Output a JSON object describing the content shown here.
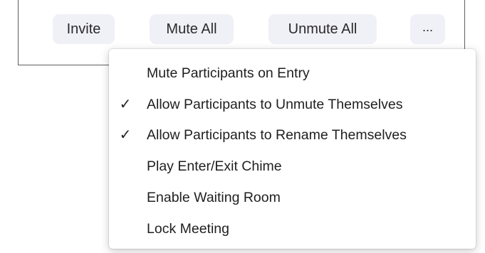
{
  "toolbar": {
    "invite_label": "Invite",
    "mute_all_label": "Mute All",
    "unmute_all_label": "Unmute All",
    "more_label": "..."
  },
  "menu": {
    "items": [
      {
        "label": "Mute Participants on Entry",
        "checked": false
      },
      {
        "label": "Allow Participants to Unmute Themselves",
        "checked": true,
        "check_glyph": "✓"
      },
      {
        "label": "Allow Participants to Rename Themselves",
        "checked": true,
        "check_glyph": "✓"
      },
      {
        "label": "Play Enter/Exit Chime",
        "checked": false
      },
      {
        "label": "Enable Waiting Room",
        "checked": false
      },
      {
        "label": "Lock Meeting",
        "checked": false
      }
    ]
  },
  "colors": {
    "button_bg": "#f0f0f7",
    "text": "#1f1f1f",
    "panel_border": "#5f5f5f"
  },
  "icons": {
    "check": "checkmark-icon"
  }
}
